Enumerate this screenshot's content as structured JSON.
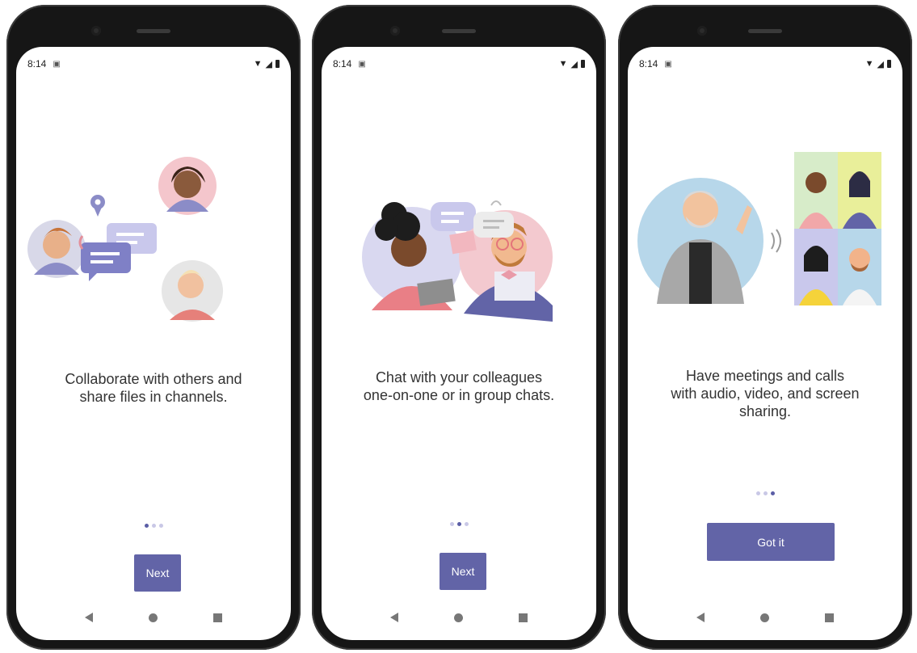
{
  "phones": [
    {
      "time": "8:14",
      "caption": "Collaborate with others and\nshare files in channels.",
      "button_label": "Next",
      "active_page": 1
    },
    {
      "time": "8:14",
      "caption": "Chat with your colleagues\none-on-one or in group chats.",
      "button_label": "Next",
      "active_page": 2
    },
    {
      "time": "8:14",
      "caption": "Have meetings and calls\nwith audio, video, and screen\nsharing.",
      "button_label": "Got it",
      "active_page": 3
    }
  ],
  "page_count": 3,
  "colors": {
    "brand": "#6264a7",
    "dot_inactive": "#c9c8e6",
    "dot_active": "#5b5ea6"
  }
}
